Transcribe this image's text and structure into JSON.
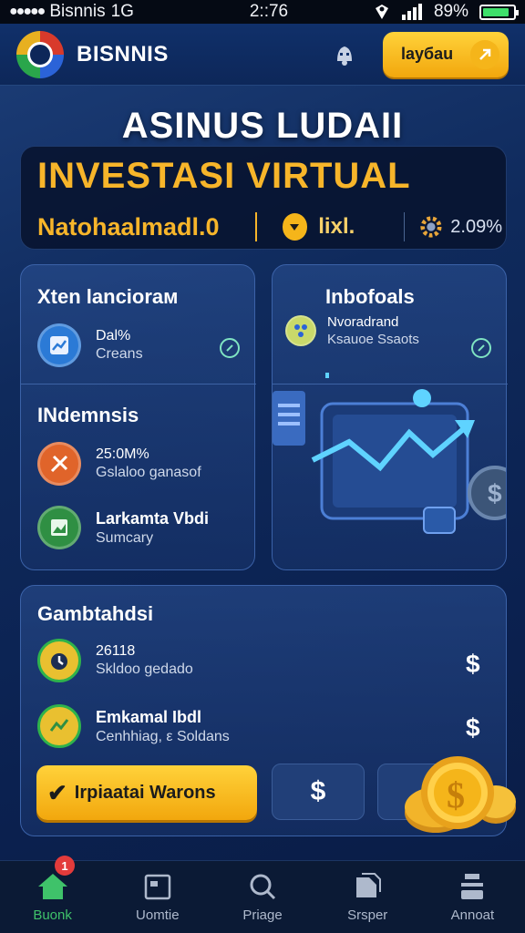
{
  "status_bar": {
    "carrier": "Bisnnis",
    "network": "1G",
    "time": "2::76",
    "battery": "89%",
    "battery_level": 0.89
  },
  "header": {
    "brand": "BISNNIS",
    "cta_label": "lаyбаu"
  },
  "hero": {
    "title": "ASINUS LUDAII",
    "headline": "INVESTASI VIRTUAL",
    "amount": "Natohaalmadl.0",
    "mid_value": "lixl.",
    "percent": "2.09%"
  },
  "left_panel": {
    "heading": "Xten lanciorам",
    "item1": {
      "title": "Dal%",
      "sub": "Creans"
    },
    "section2_heading": "INdemnsis",
    "item2": {
      "title": "25:0M%",
      "sub": "Gslaloo ganasof"
    },
    "item3": {
      "title": "Larkamta Vbdi",
      "sub": "Sumcary"
    }
  },
  "right_panel": {
    "heading": "Inbofoals",
    "item1": {
      "title": "Nvoradrand",
      "sub": "Ksauoe Ssaots"
    }
  },
  "bottom_panel": {
    "heading": "Gambtahdsi",
    "item1": {
      "title": "26118",
      "sub": "Skldoo gedado"
    },
    "item2": {
      "title": "Emkamal Ibdl",
      "sub": "Cenhhiag, ε Soldans"
    },
    "dollar_sign": "$",
    "action_label": "Irpiaatai Warons"
  },
  "bottom_nav": {
    "items": [
      {
        "label": "Buonk",
        "icon": "home-icon",
        "badge": "1"
      },
      {
        "label": "Uomtie",
        "icon": "calendar-icon"
      },
      {
        "label": "Priage",
        "icon": "search-icon"
      },
      {
        "label": "Srsper",
        "icon": "document-icon"
      },
      {
        "label": "Annoat",
        "icon": "profile-icon"
      }
    ]
  },
  "colors": {
    "accent_gold": "#f7b52a",
    "nav_active": "#3fc26a",
    "background": "#0f2a5c"
  }
}
